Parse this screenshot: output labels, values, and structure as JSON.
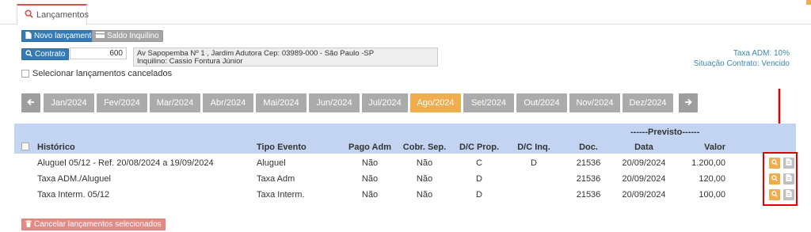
{
  "tab": {
    "label": "Lançamentos",
    "icon": "search-icon"
  },
  "toolbar": {
    "novo_label": "Novo lançamento",
    "saldo_label": "Saldo Inquilino",
    "contrato_label": "Contrato",
    "contrato_value": "600"
  },
  "address": {
    "line1": "Av Sapopemba Nº 1 , Jardim Adutora Cep: 03989-000 - São Paulo -SP",
    "line2": "Inquilino: Cassio Fontura Júnior"
  },
  "info": {
    "taxa_adm": "Taxa ADM: 10%",
    "situacao": "Situação Contrato: Vencido"
  },
  "cancelados_label": "Selecionar lançamentos cancelados",
  "months": [
    "Jan/2024",
    "Fev/2024",
    "Mar/2024",
    "Abr/2024",
    "Mai/2024",
    "Jun/2024",
    "Jul/2024",
    "Ago/2024",
    "Set/2024",
    "Out/2024",
    "Nov/2024",
    "Dez/2024"
  ],
  "active_month": "Ago/2024",
  "table": {
    "previsto_label": "------Previsto------",
    "headers": {
      "historico": "Histórico",
      "tipo_evento": "Tipo Evento",
      "pago_adm": "Pago Adm",
      "cobr_sep": "Cobr. Sep.",
      "dc_prop": "D/C Prop.",
      "dc_inq": "D/C Inq.",
      "doc": "Doc.",
      "data": "Data",
      "valor": "Valor"
    },
    "rows": [
      {
        "historico": "Aluguel 05/12 - Ref. 20/08/2024 a 19/09/2024",
        "tipo_evento": "Aluguel",
        "pago_adm": "Não",
        "cobr_sep": "Não",
        "dc_prop": "C",
        "dc_inq": "D",
        "doc": "21536",
        "data": "20/09/2024",
        "valor": "1.200,00"
      },
      {
        "historico": "Taxa ADM./Aluguel",
        "tipo_evento": "Taxa Adm",
        "pago_adm": "Não",
        "cobr_sep": "Não",
        "dc_prop": "D",
        "dc_inq": "",
        "doc": "21536",
        "data": "20/09/2024",
        "valor": "120,00"
      },
      {
        "historico": "Taxa Interm. 05/12",
        "tipo_evento": "Taxa Interm.",
        "pago_adm": "Não",
        "cobr_sep": "Não",
        "dc_prop": "D",
        "dc_inq": "",
        "doc": "21536",
        "data": "20/09/2024",
        "valor": "100,00"
      }
    ]
  },
  "cancel_button_label": "Cancelar lançamentos selecionados",
  "colors": {
    "primary": "#337ab7",
    "month_default": "#ababab",
    "month_active": "#f0ad4e",
    "header_bg": "#c3d4f2",
    "highlight": "#e00000",
    "danger": "#e38a86"
  }
}
